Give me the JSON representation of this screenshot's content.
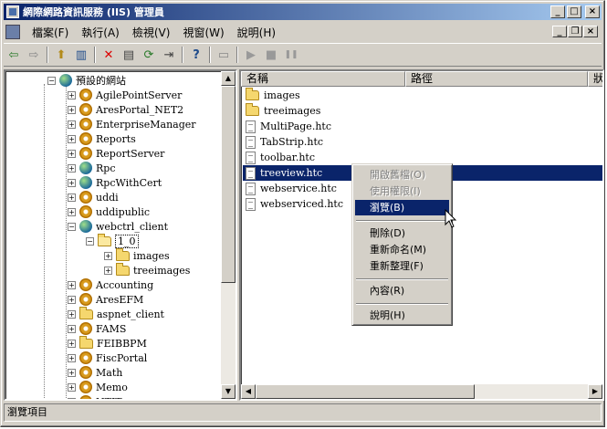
{
  "window": {
    "title": "網際網路資訊服務 (IIS) 管理員"
  },
  "titlebar_buttons": {
    "minimize": "_",
    "maximize": "□",
    "close": "×"
  },
  "menubar": {
    "items": [
      "檔案(F)",
      "執行(A)",
      "檢視(V)",
      "視窗(W)",
      "說明(H)"
    ]
  },
  "mdi_buttons": {
    "minimize": "_",
    "restore": "❐",
    "close": "×"
  },
  "toolbar": {
    "icons": [
      "back-icon",
      "forward-icon",
      "up-folder-icon",
      "show-tree-icon",
      "delete-icon",
      "properties-icon",
      "refresh-icon",
      "export-icon",
      "help-icon",
      "computer-icon",
      "start-icon",
      "stop-icon",
      "pause-icon"
    ],
    "glyphs": {
      "back": "⇦",
      "forward": "⇨",
      "up": "⬆",
      "tree": "▥",
      "delete": "✕",
      "properties": "▤",
      "refresh": "⟳",
      "export": "⇥",
      "help": "?",
      "computer": "▭",
      "start": "▶",
      "stop": "■",
      "pause": "❚❚"
    }
  },
  "tree": {
    "root": "預設的網站",
    "items": [
      {
        "label": "AgilePointServer",
        "icon": "gear-icon"
      },
      {
        "label": "AresPortal_NET2",
        "icon": "gear-icon"
      },
      {
        "label": "EnterpriseManager",
        "icon": "gear-icon"
      },
      {
        "label": "Reports",
        "icon": "gear-icon"
      },
      {
        "label": "ReportServer",
        "icon": "gear-icon"
      },
      {
        "label": "Rpc",
        "icon": "globe-icon"
      },
      {
        "label": "RpcWithCert",
        "icon": "globe-icon"
      },
      {
        "label": "uddi",
        "icon": "gear-icon"
      },
      {
        "label": "uddipublic",
        "icon": "gear-icon"
      },
      {
        "label": "webctrl_client",
        "icon": "globe-icon"
      },
      {
        "label": "1_0",
        "icon": "folder-icon"
      },
      {
        "label": "images",
        "icon": "folder-icon"
      },
      {
        "label": "treeimages",
        "icon": "folder-icon"
      },
      {
        "label": "Accounting",
        "icon": "gear-icon"
      },
      {
        "label": "AresEFM",
        "icon": "gear-icon"
      },
      {
        "label": "aspnet_client",
        "icon": "folder-icon"
      },
      {
        "label": "FAMS",
        "icon": "gear-icon"
      },
      {
        "label": "FEIBBPM",
        "icon": "folder-icon"
      },
      {
        "label": "FiscPortal",
        "icon": "gear-icon"
      },
      {
        "label": "Math",
        "icon": "gear-icon"
      },
      {
        "label": "Memo",
        "icon": "gear-icon"
      },
      {
        "label": "NTIT",
        "icon": "gear-icon"
      }
    ],
    "expander_collapsed": "+",
    "expander_expanded": "−"
  },
  "list": {
    "columns": [
      "名稱",
      "路徑",
      "狀"
    ],
    "rows": [
      {
        "name": "images",
        "icon": "folder-icon"
      },
      {
        "name": "treeimages",
        "icon": "folder-icon"
      },
      {
        "name": "MultiPage.htc",
        "icon": "file-icon"
      },
      {
        "name": "TabStrip.htc",
        "icon": "file-icon"
      },
      {
        "name": "toolbar.htc",
        "icon": "file-icon"
      },
      {
        "name": "treeview.htc",
        "icon": "file-icon"
      },
      {
        "name": "webservice.htc",
        "icon": "file-icon"
      },
      {
        "name": "webserviced.htc",
        "icon": "file-icon"
      }
    ],
    "selected": "treeview.htc"
  },
  "context_menu": {
    "items": [
      "開啟舊檔(O)",
      "使用權限(I)",
      "瀏覽(B)",
      "刪除(D)",
      "重新命名(M)",
      "重新整理(F)",
      "內容(R)",
      "說明(H)"
    ],
    "disabled": [
      "開啟舊檔(O)",
      "使用權限(I)"
    ],
    "highlighted": "瀏覽(B)"
  },
  "scroll_glyphs": {
    "up": "▲",
    "down": "▼",
    "left": "◀",
    "right": "▶"
  },
  "status": {
    "text": "瀏覽項目"
  },
  "colors": {
    "title_start": "#0a246a",
    "title_end": "#a6caf0",
    "selection": "#0a246a",
    "chrome": "#d4d0c8"
  }
}
